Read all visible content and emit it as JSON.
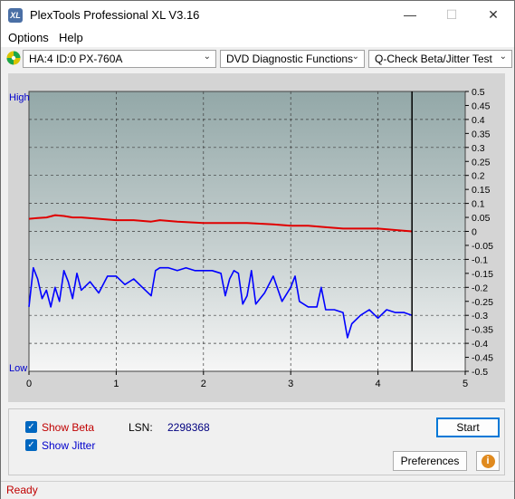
{
  "window": {
    "title": "PlexTools Professional XL V3.16",
    "icon_text": "XL"
  },
  "window_controls": {
    "minimize": "—",
    "maximize": "☐",
    "close": "✕"
  },
  "menu": {
    "items": [
      "Options",
      "Help"
    ]
  },
  "toolbar": {
    "drive": "HA:4 ID:0  PX-760A",
    "function": "DVD Diagnostic Functions",
    "test": "Q-Check Beta/Jitter Test"
  },
  "chart_data": {
    "type": "line",
    "x_ticks": [
      "0",
      "1",
      "2",
      "3",
      "4",
      "5"
    ],
    "xlim": [
      0,
      5
    ],
    "ylim": [
      -0.5,
      0.5
    ],
    "y_ticks": [
      "0.5",
      "0.45",
      "0.4",
      "0.35",
      "0.3",
      "0.25",
      "0.2",
      "0.15",
      "0.1",
      "0.05",
      "0",
      "-0.05",
      "-0.1",
      "-0.15",
      "-0.2",
      "-0.25",
      "-0.3",
      "-0.35",
      "-0.4",
      "-0.45",
      "-0.5"
    ],
    "left_labels": {
      "top": "High",
      "bottom": "Low"
    },
    "cursor_x": 4.39,
    "colors": {
      "beta": "#e00000",
      "jitter": "#0000ff",
      "label": "#0000cc"
    },
    "series": [
      {
        "name": "Beta",
        "x": [
          0.0,
          0.1,
          0.2,
          0.3,
          0.4,
          0.5,
          0.6,
          0.8,
          1.0,
          1.2,
          1.4,
          1.5,
          1.7,
          2.0,
          2.2,
          2.5,
          2.8,
          3.0,
          3.2,
          3.4,
          3.6,
          3.8,
          4.0,
          4.2,
          4.39
        ],
        "y": [
          0.045,
          0.048,
          0.05,
          0.058,
          0.055,
          0.05,
          0.05,
          0.045,
          0.04,
          0.04,
          0.035,
          0.04,
          0.035,
          0.03,
          0.03,
          0.03,
          0.025,
          0.02,
          0.02,
          0.015,
          0.01,
          0.01,
          0.01,
          0.005,
          0.0
        ]
      },
      {
        "name": "Jitter",
        "x": [
          0.0,
          0.05,
          0.1,
          0.15,
          0.2,
          0.25,
          0.3,
          0.35,
          0.4,
          0.45,
          0.5,
          0.55,
          0.6,
          0.7,
          0.8,
          0.9,
          1.0,
          1.1,
          1.2,
          1.3,
          1.4,
          1.45,
          1.5,
          1.6,
          1.7,
          1.8,
          1.9,
          2.0,
          2.1,
          2.2,
          2.25,
          2.3,
          2.35,
          2.4,
          2.45,
          2.5,
          2.55,
          2.6,
          2.7,
          2.8,
          2.9,
          3.0,
          3.05,
          3.1,
          3.2,
          3.3,
          3.35,
          3.4,
          3.5,
          3.6,
          3.65,
          3.7,
          3.8,
          3.9,
          4.0,
          4.1,
          4.2,
          4.3,
          4.39
        ],
        "y": [
          -0.27,
          -0.13,
          -0.17,
          -0.24,
          -0.21,
          -0.27,
          -0.2,
          -0.25,
          -0.14,
          -0.18,
          -0.24,
          -0.15,
          -0.21,
          -0.18,
          -0.22,
          -0.16,
          -0.16,
          -0.19,
          -0.17,
          -0.2,
          -0.23,
          -0.14,
          -0.13,
          -0.13,
          -0.14,
          -0.13,
          -0.14,
          -0.14,
          -0.14,
          -0.15,
          -0.23,
          -0.17,
          -0.14,
          -0.15,
          -0.26,
          -0.23,
          -0.14,
          -0.26,
          -0.22,
          -0.16,
          -0.25,
          -0.2,
          -0.16,
          -0.25,
          -0.27,
          -0.27,
          -0.2,
          -0.28,
          -0.28,
          -0.29,
          -0.38,
          -0.33,
          -0.3,
          -0.28,
          -0.31,
          -0.28,
          -0.29,
          -0.29,
          -0.3
        ]
      }
    ]
  },
  "options": {
    "show_beta": "Show Beta",
    "show_jitter": "Show Jitter",
    "lsn_label": "LSN:",
    "lsn_value": "2298368",
    "check_mark": "✓"
  },
  "buttons": {
    "start": "Start",
    "preferences": "Preferences",
    "info": "i"
  },
  "status": {
    "text": "Ready"
  }
}
